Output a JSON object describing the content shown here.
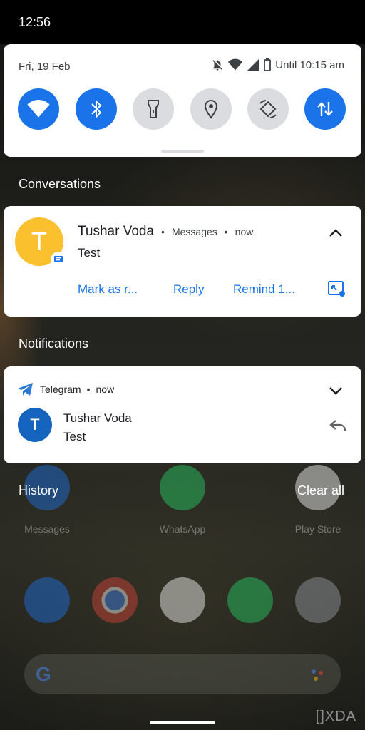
{
  "status_bar": {
    "time": "12:56"
  },
  "quick_settings": {
    "date": "Fri, 19 Feb",
    "battery_text": "Until 10:15 am",
    "status_icons": [
      "bell-off-icon",
      "wifi-icon",
      "signal-icon",
      "battery-icon"
    ],
    "tiles": [
      {
        "name": "wifi",
        "icon": "wifi-icon",
        "on": true
      },
      {
        "name": "bluetooth",
        "icon": "bluetooth-icon",
        "on": true
      },
      {
        "name": "flashlight",
        "icon": "flashlight-icon",
        "on": false
      },
      {
        "name": "location",
        "icon": "location-icon",
        "on": false
      },
      {
        "name": "auto-rotate",
        "icon": "rotate-icon",
        "on": false
      },
      {
        "name": "mobile-data",
        "icon": "data-arrows-icon",
        "on": true
      }
    ],
    "accent_on": "#1a73e8",
    "tile_off": "#dadce0"
  },
  "conversations": {
    "section_title": "Conversations",
    "card": {
      "avatar_letter": "T",
      "avatar_color": "#fbc02d",
      "sender": "Tushar Voda",
      "separator": "•",
      "app": "Messages",
      "time": "now",
      "message": "Test",
      "actions": [
        "Mark as r...",
        "Reply",
        "Remind 1..."
      ]
    }
  },
  "notifications": {
    "section_title": "Notifications",
    "card": {
      "app": "Telegram",
      "separator": "•",
      "time": "now",
      "avatar_letter": "T",
      "avatar_color": "#1565c0",
      "sender": "Tushar Voda",
      "message": "Test"
    }
  },
  "footer": {
    "history": "History",
    "clear_all": "Clear all"
  },
  "home_screen": {
    "apps_row": [
      "Messages",
      "WhatsApp",
      "Play Store"
    ]
  },
  "watermark": "[]XDA"
}
